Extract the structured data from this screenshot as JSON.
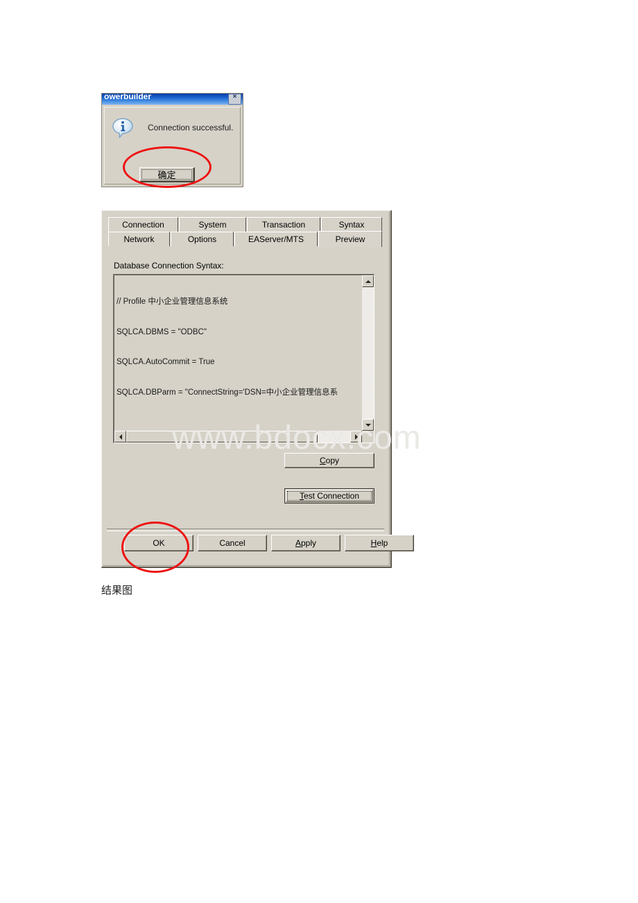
{
  "messagebox": {
    "title": "PowerBuilder",
    "title_visible": "owerbuilder",
    "close_glyph": "×",
    "icon": "info-icon",
    "message": "Connection successful.",
    "ok_label": "确定"
  },
  "dialog": {
    "tabs_row1": [
      {
        "label": "Connection",
        "active": false
      },
      {
        "label": "System",
        "active": false
      },
      {
        "label": "Transaction",
        "active": false
      },
      {
        "label": "Syntax",
        "active": false
      }
    ],
    "tabs_row2": [
      {
        "label": "Network",
        "active": false
      },
      {
        "label": "Options",
        "active": false
      },
      {
        "label": "EAServer/MTS",
        "active": false
      },
      {
        "label": "Preview",
        "active": true
      }
    ],
    "syntax_label": "Database Connection Syntax:",
    "syntax_lines": [
      "// Profile 中小企业管理信息系统",
      "SQLCA.DBMS = \"ODBC\"",
      "SQLCA.AutoCommit = True",
      "SQLCA.DBParm = \"ConnectString='DSN=中小企业管理信息系"
    ],
    "copy_button": {
      "pre": "",
      "accel": "C",
      "post": "opy"
    },
    "test_button": {
      "pre": "",
      "accel": "T",
      "post": "est Connection"
    },
    "ok_button": {
      "pre": "OK",
      "accel": "",
      "post": ""
    },
    "cancel_button": {
      "pre": "Cancel",
      "accel": "",
      "post": ""
    },
    "apply_button": {
      "pre": "",
      "accel": "A",
      "post": "pply"
    },
    "help_button": {
      "pre": "",
      "accel": "H",
      "post": "elp"
    }
  },
  "annotations": {
    "ring_color": "#ee1111",
    "ring_ok_cn": "red-ellipse-around-confirm-button",
    "ring_ok_dialog": "red-ellipse-around-ok-button"
  },
  "watermark": {
    "text": "www.bdocx.com",
    "color": "#ebe9e6"
  },
  "caption": "结果图"
}
